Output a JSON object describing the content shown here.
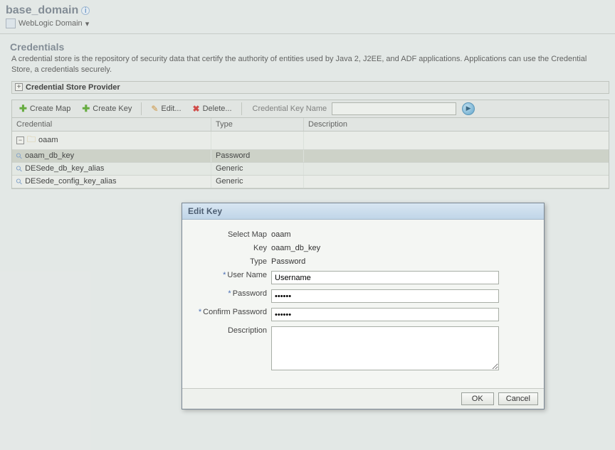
{
  "header": {
    "domain_title": "base_domain",
    "breadcrumb_label": "WebLogic Domain"
  },
  "section": {
    "title": "Credentials",
    "description": "A credential store is the repository of security data that certify the authority of entities used by Java 2, J2EE, and ADF applications. Applications can use the Credential Store, a credentials securely.",
    "provider_label": "Credential Store Provider"
  },
  "toolbar": {
    "create_map": "Create Map",
    "create_key": "Create Key",
    "edit": "Edit...",
    "delete": "Delete...",
    "search_label": "Credential Key Name",
    "search_value": ""
  },
  "table": {
    "col_credential": "Credential",
    "col_type": "Type",
    "col_description": "Description",
    "rows": [
      {
        "name": "oaam",
        "type": "",
        "desc": "",
        "kind": "folder"
      },
      {
        "name": "oaam_db_key",
        "type": "Password",
        "desc": "",
        "kind": "key",
        "selected": true
      },
      {
        "name": "DESede_db_key_alias",
        "type": "Generic",
        "desc": "",
        "kind": "key"
      },
      {
        "name": "DESede_config_key_alias",
        "type": "Generic",
        "desc": "",
        "kind": "key"
      }
    ]
  },
  "dialog": {
    "title": "Edit Key",
    "labels": {
      "select_map": "Select Map",
      "key": "Key",
      "type": "Type",
      "username": "User Name",
      "password": "Password",
      "confirm_password": "Confirm Password",
      "description": "Description"
    },
    "values": {
      "select_map": "oaam",
      "key": "oaam_db_key",
      "type": "Password",
      "username": "Username",
      "password": "••••••",
      "confirm_password": "••••••",
      "description": ""
    },
    "buttons": {
      "ok": "OK",
      "cancel": "Cancel"
    }
  }
}
